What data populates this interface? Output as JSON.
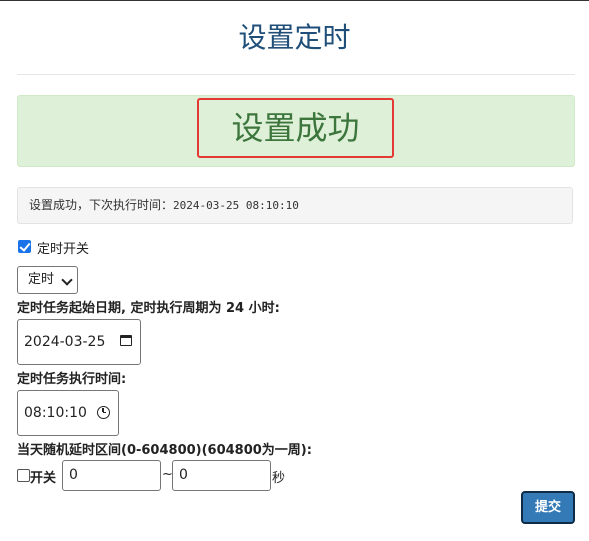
{
  "page": {
    "title": "设置定时"
  },
  "alert": {
    "message": "设置成功"
  },
  "info": {
    "prefix": "设置成功，下次执行时间：",
    "next_run": "2024-03-25 08:10:10"
  },
  "form": {
    "enable_label": "定时开关",
    "enable_checked": true,
    "mode_select": {
      "value": "定时"
    },
    "start_date_label": "定时任务起始日期, 定时执行周期为 24 小时:",
    "start_date_value": "2024-03-25",
    "exec_time_label": "定时任务执行时间:",
    "exec_time_value": "08:10:10",
    "random_delay_label": "当天随机延时区间(0-604800)(604800为一周):",
    "random_toggle_label": "开关",
    "random_toggle_checked": false,
    "random_min": "0",
    "random_separator": "~",
    "random_max": "0",
    "random_unit": "秒",
    "submit_label": "提交"
  },
  "colors": {
    "title": "#1f4e79",
    "alert_bg": "#dff0d8",
    "alert_text": "#3c763d",
    "highlight_border": "#e53935",
    "button_bg": "#337ab7"
  },
  "icons": {
    "date_picker": "calendar-icon",
    "time_picker": "clock-icon",
    "select_arrow": "chevron-down-icon"
  }
}
